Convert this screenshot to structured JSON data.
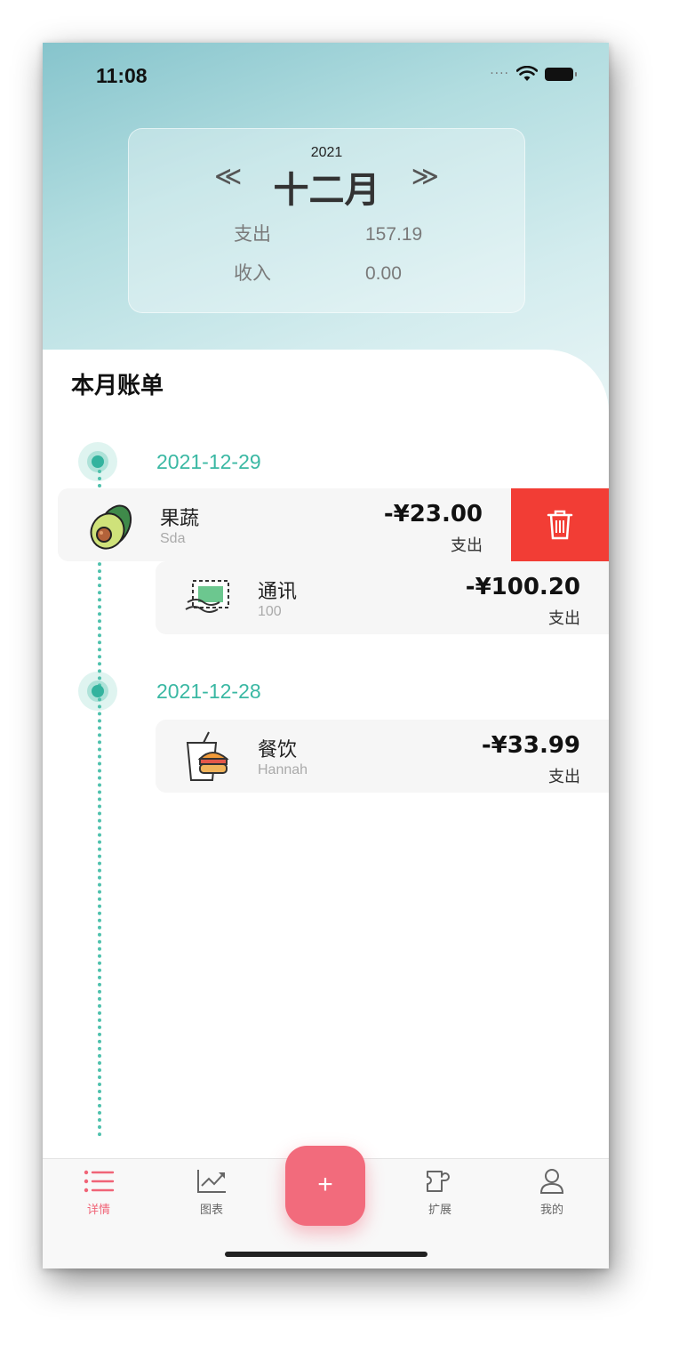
{
  "status": {
    "time": "11:08"
  },
  "header": {
    "year": "2021",
    "month": "十二月",
    "prev_arrow": "≪",
    "next_arrow": "≫",
    "expense_label": "支出",
    "expense_value": "157.19",
    "income_label": "收入",
    "income_value": "0.00"
  },
  "bills": {
    "title": "本月账单",
    "groups": [
      {
        "date": "2021-12-29",
        "items": [
          {
            "icon": "avocado-icon",
            "name": "果蔬",
            "note": "Sda",
            "amount": "-¥23.00",
            "kind": "支出"
          },
          {
            "icon": "stamp-icon",
            "name": "通讯",
            "note": "100",
            "amount": "-¥100.20",
            "kind": "支出"
          }
        ]
      },
      {
        "date": "2021-12-28",
        "items": [
          {
            "icon": "burger-drink-icon",
            "name": "餐饮",
            "note": "Hannah",
            "amount": "-¥33.99",
            "kind": "支出"
          }
        ]
      }
    ]
  },
  "tabs": [
    {
      "label": "详情",
      "icon": "list-icon",
      "active": true
    },
    {
      "label": "图表",
      "icon": "chart-icon"
    },
    {
      "label": "扩展",
      "icon": "puzzle-icon"
    },
    {
      "label": "我的",
      "icon": "user-icon"
    }
  ],
  "fab": {
    "label": "+"
  },
  "colors": {
    "accent": "#f26b7c",
    "teal": "#3ab8a3",
    "delete": "#f23d35"
  }
}
